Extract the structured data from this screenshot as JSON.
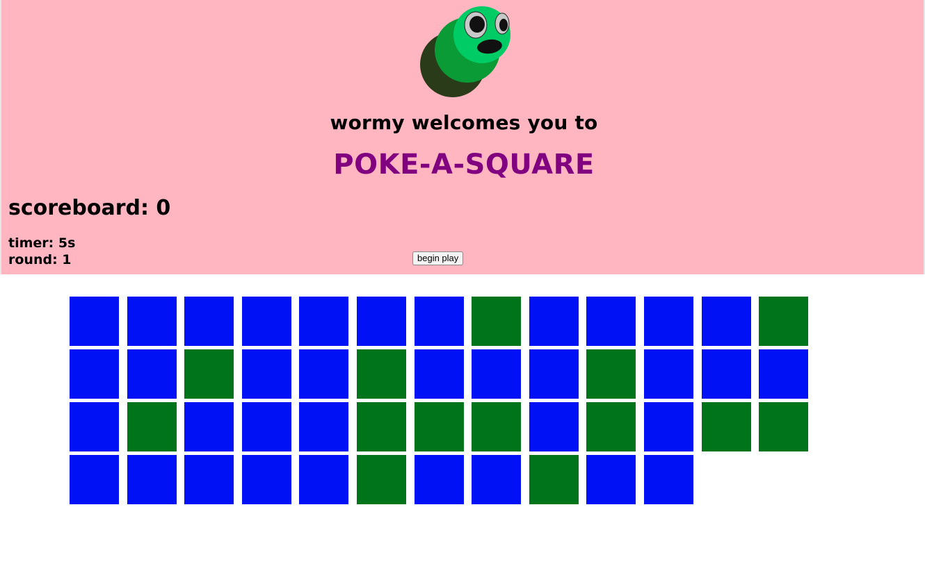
{
  "header": {
    "tagline": "wormy welcomes you to",
    "title": "POKE-A-SQUARE",
    "scoreboard": "scoreboard: 0",
    "timer": "timer: 5s",
    "round": "round: 1",
    "begin_label": "begin play"
  },
  "colors": {
    "header_bg": "#ffb6c1",
    "title": "#800080",
    "square_blue": "#0012f5",
    "square_green": "#00741a",
    "worm_head": "#00cc66",
    "worm_mid": "#0a9a36",
    "worm_tail": "#2a3b1a"
  },
  "board": {
    "columns": 13,
    "squares": [
      "blue",
      "blue",
      "blue",
      "blue",
      "blue",
      "blue",
      "blue",
      "green",
      "blue",
      "blue",
      "blue",
      "blue",
      "green",
      "blue",
      "blue",
      "green",
      "blue",
      "blue",
      "green",
      "blue",
      "blue",
      "blue",
      "green",
      "blue",
      "blue",
      "blue",
      "blue",
      "green",
      "blue",
      "blue",
      "blue",
      "green",
      "green",
      "green",
      "blue",
      "green",
      "blue",
      "green",
      "green",
      "blue",
      "blue",
      "blue",
      "blue",
      "blue",
      "green",
      "blue",
      "blue",
      "green",
      "blue",
      "blue"
    ]
  }
}
